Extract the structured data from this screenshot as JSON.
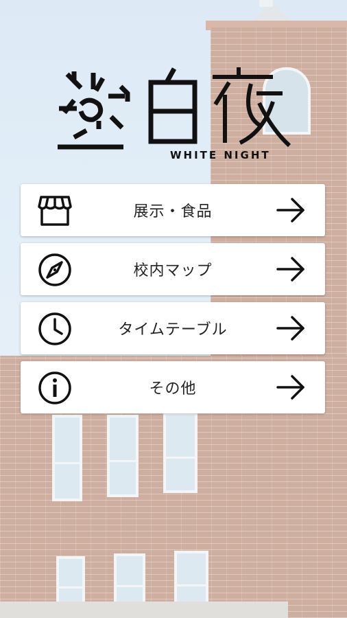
{
  "app": {
    "logo_text_main": "白夜",
    "logo_text_sub": "WHITE NIGHT"
  },
  "menu": {
    "items": [
      {
        "label": "展示・食品",
        "icon": "store-icon"
      },
      {
        "label": "校内マップ",
        "icon": "compass-icon"
      },
      {
        "label": "タイムテーブル",
        "icon": "clock-icon"
      },
      {
        "label": "その他",
        "icon": "info-icon"
      }
    ],
    "arrow_icon": "arrow-right-icon"
  },
  "colors": {
    "card": "#ffffff",
    "text": "#222222",
    "brick": "#b98b76",
    "sky": "#cfe1f2"
  }
}
